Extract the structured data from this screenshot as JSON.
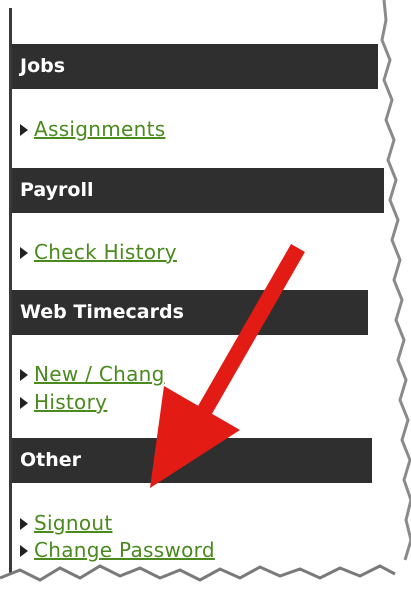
{
  "sections": [
    {
      "title": "Jobs",
      "links": [
        "Assignments"
      ]
    },
    {
      "title": "Payroll",
      "links": [
        "Check History"
      ]
    },
    {
      "title": "Web Timecards",
      "links": [
        "New / Chang",
        "History"
      ]
    },
    {
      "title": "Other",
      "links": [
        "Signout",
        "Change Password"
      ]
    }
  ],
  "colors": {
    "header_bg": "#2f2f2f",
    "link": "#4a8a1e",
    "arrow": "#e21b14"
  },
  "icons": {
    "bullet": "right-triangle-bullet-icon",
    "annotation": "red-arrow-annotation"
  }
}
